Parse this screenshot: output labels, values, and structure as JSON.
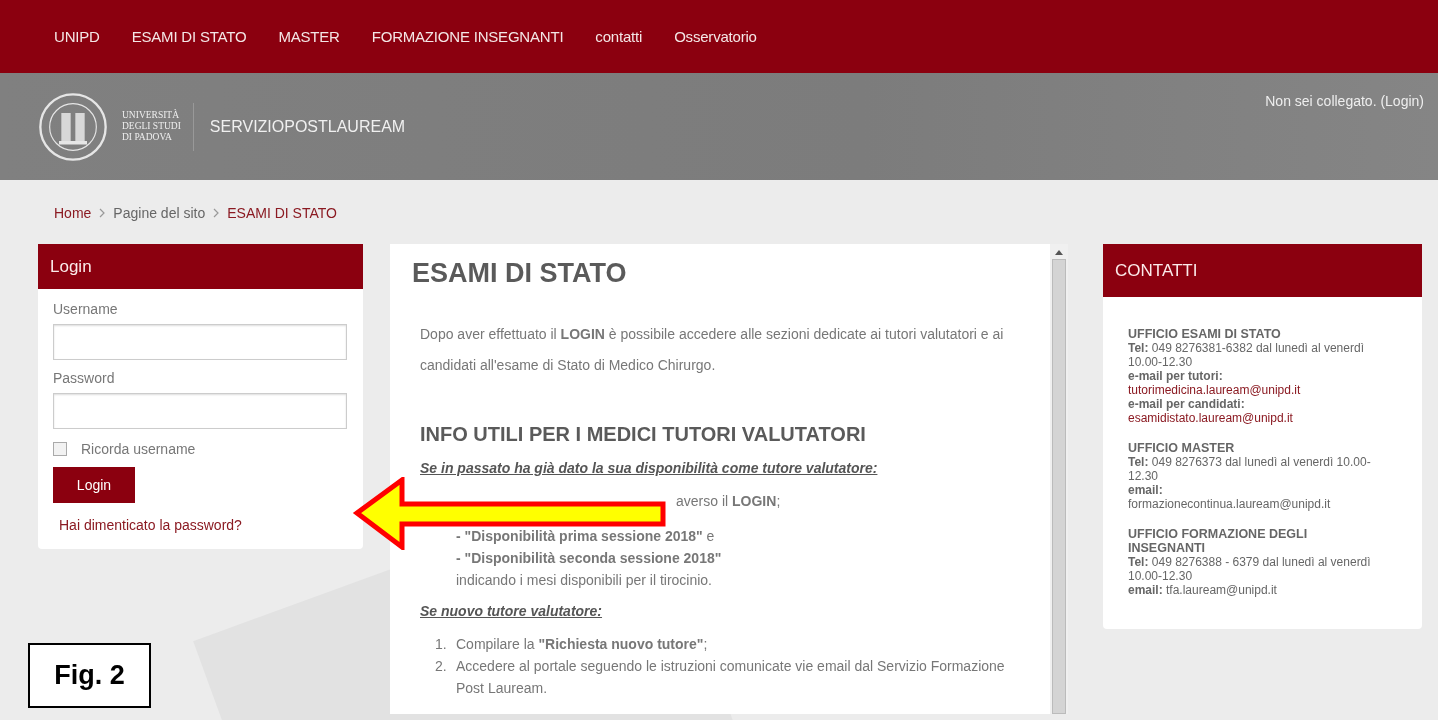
{
  "nav": [
    {
      "label": "UNIPD"
    },
    {
      "label": "ESAMI DI STATO"
    },
    {
      "label": "MASTER"
    },
    {
      "label": "FORMAZIONE INSEGNANTI"
    },
    {
      "label": "contatti"
    },
    {
      "label": "Osservatorio"
    }
  ],
  "header": {
    "logo_lines": [
      "UNIVERSITÀ",
      "DEGLI STUDI",
      "DI PADOVA"
    ],
    "site_name": "SERVIZIOPOSTLAUREAM",
    "login_status": "Non sei collegato. (Login)"
  },
  "breadcrumb": [
    {
      "label": "Home",
      "kind": "link"
    },
    {
      "label": "Pagine del sito",
      "kind": "text"
    },
    {
      "label": "ESAMI DI STATO",
      "kind": "current"
    }
  ],
  "login": {
    "title": "Login",
    "username_label": "Username",
    "password_label": "Password",
    "remember": {
      "label": "Ricorda username",
      "checked": false
    },
    "button": "Login",
    "forgot_link": "Hai dimenticato la password?"
  },
  "content": {
    "title": "ESAMI DI STATO",
    "intro": "Dopo aver effettuato il **LOGIN** è possibile accedere alle sezioni dedicate ai tutori valutatori e ai candidati all'esame di Stato di Medico Chirurgo.",
    "section_title": "INFO UTILI PER I MEDICI TUTORI VALUTATORI",
    "blocks": [
      {
        "kind": "subheading",
        "text": "Se in passato ha già dato la sua disponibilità come tutore valutatore:"
      },
      {
        "kind": "covered",
        "lines": [
          "averso il **LOGIN**;"
        ]
      },
      {
        "kind": "lines",
        "lines": [
          "**- \"Disponibilità prima sessione 2018\"** e",
          "**- \"Disponibilità seconda sessione 2018\"**",
          "indicando i mesi disponibili per il tirocinio."
        ]
      },
      {
        "kind": "subheading",
        "text": "Se nuovo tutore valutatore:"
      },
      {
        "kind": "list",
        "items": [
          {
            "number": "1.",
            "text": "Compilare la **\"Richiesta nuovo tutore\"**;"
          },
          {
            "number": "2.",
            "text": "Accedere al portale seguendo le istruzioni comunicate vie email dal Servizio Formazione Post Lauream."
          }
        ]
      }
    ]
  },
  "contacts": {
    "title": "CONTATTI",
    "offices": [
      {
        "name": "UFFICIO ESAMI DI STATO",
        "lines": [
          {
            "kind": "text",
            "text": "**Tel:** 049 8276381-6382 dal lunedì al venerdì 10.00-12.30"
          },
          {
            "kind": "label",
            "text": "e-mail per tutori:"
          },
          {
            "kind": "link",
            "text": "tutorimedicina.lauream@unipd.it"
          },
          {
            "kind": "label",
            "text": "e-mail per candidati:"
          },
          {
            "kind": "link",
            "text": "esamidistato.lauream@unipd.it"
          }
        ]
      },
      {
        "name": "UFFICIO MASTER",
        "lines": [
          {
            "kind": "text",
            "text": "**Tel:** 049 8276373 dal lunedì al venerdì 10.00-12.30"
          },
          {
            "kind": "label",
            "text": "email:"
          },
          {
            "kind": "text",
            "text": "formazionecontinua.lauream@unipd.it"
          }
        ]
      },
      {
        "name": "UFFICIO FORMAZIONE DEGLI INSEGNANTI",
        "lines": [
          {
            "kind": "text",
            "text": "**Tel:** 049 8276388 - 6379 dal lunedì al venerdì  10.00-12.30"
          },
          {
            "kind": "text",
            "text": "**email:** tfa.lauream@unipd.it"
          }
        ]
      }
    ]
  },
  "figure_label": "Fig. 2"
}
